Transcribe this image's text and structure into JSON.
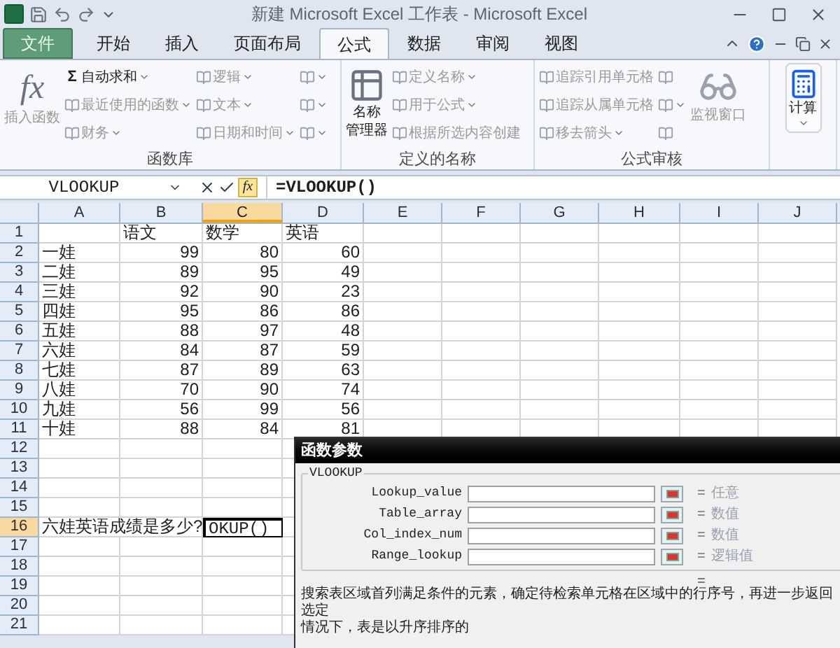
{
  "window": {
    "title": "新建 Microsoft Excel 工作表 - Microsoft Excel"
  },
  "tabs": [
    {
      "label": "文件",
      "kind": "file",
      "selected": false
    },
    {
      "label": "开始",
      "kind": "tab",
      "selected": false
    },
    {
      "label": "插入",
      "kind": "tab",
      "selected": false
    },
    {
      "label": "页面布局",
      "kind": "tab",
      "selected": false
    },
    {
      "label": "公式",
      "kind": "tab",
      "selected": true
    },
    {
      "label": "数据",
      "kind": "tab",
      "selected": false
    },
    {
      "label": "审阅",
      "kind": "tab",
      "selected": false
    },
    {
      "label": "视图",
      "kind": "tab",
      "selected": false
    }
  ],
  "ribbon": [
    {
      "label": "函数库",
      "items": [
        {
          "kind": "large",
          "glyph": "fx",
          "lines": [
            "插入函数"
          ],
          "disabled": true
        },
        {
          "kind": "stack",
          "buttons": [
            {
              "glyph": "Σ",
              "label": "自动求和",
              "dropdown": true,
              "disabled": false
            },
            {
              "label": "最近使用的函数",
              "dropdown": true,
              "disabled": true
            },
            {
              "label": "财务",
              "dropdown": true,
              "disabled": true
            }
          ]
        },
        {
          "kind": "stack",
          "buttons": [
            {
              "label": "逻辑",
              "dropdown": true,
              "disabled": true
            },
            {
              "label": "文本",
              "dropdown": true,
              "disabled": true
            },
            {
              "label": "日期和时间",
              "dropdown": true,
              "disabled": true
            }
          ]
        },
        {
          "kind": "stack",
          "buttons": [
            {
              "dropdown": true,
              "disabled": true
            },
            {
              "dropdown": true,
              "disabled": true
            },
            {
              "dropdown": true,
              "disabled": true
            }
          ]
        }
      ]
    },
    {
      "label": "定义的名称",
      "items": [
        {
          "kind": "large",
          "lines": [
            "名称",
            "管理器"
          ],
          "disabled": false
        },
        {
          "kind": "stack",
          "buttons": [
            {
              "label": "定义名称",
              "dropdown": true,
              "disabled": true
            },
            {
              "label": "用于公式",
              "dropdown": true,
              "disabled": true
            },
            {
              "label": "根据所选内容创建",
              "dropdown": false,
              "disabled": true
            }
          ]
        }
      ]
    },
    {
      "label": "公式审核",
      "items": [
        {
          "kind": "stack",
          "buttons": [
            {
              "label": "追踪引用单元格",
              "dropdown": false,
              "disabled": true
            },
            {
              "label": "追踪从属单元格",
              "dropdown": false,
              "disabled": true
            },
            {
              "label": "移去箭头",
              "dropdown": true,
              "disabled": true
            }
          ]
        },
        {
          "kind": "stack",
          "buttons": [
            {
              "dropdown": false,
              "disabled": true
            },
            {
              "dropdown": true,
              "disabled": true
            },
            {
              "dropdown": false,
              "disabled": true
            }
          ]
        },
        {
          "kind": "large",
          "lines": [
            "监视窗口"
          ],
          "disabled": true
        }
      ]
    },
    {
      "items": [
        {
          "kind": "large",
          "lines": [
            "计算"
          ],
          "dropdown": true,
          "disabled": false
        }
      ]
    }
  ],
  "formula_bar": {
    "name_box": "VLOOKUP",
    "fx": "fx",
    "formula": "=VLOOKUP()"
  },
  "columns": [
    {
      "label": "A",
      "selected": false
    },
    {
      "label": "B",
      "selected": false
    },
    {
      "label": "C",
      "selected": true
    },
    {
      "label": "D",
      "selected": false
    },
    {
      "label": "E",
      "selected": false
    },
    {
      "label": "F",
      "selected": false
    },
    {
      "label": "G",
      "selected": false
    },
    {
      "label": "H",
      "selected": false
    },
    {
      "label": "I",
      "selected": false
    },
    {
      "label": "J",
      "selected": false
    }
  ],
  "rows": [
    {
      "header": "1",
      "kind": "titles",
      "selected": false,
      "cells": [
        "",
        "语文",
        "数学",
        "英语"
      ]
    },
    {
      "header": "2",
      "kind": "record",
      "selected": false,
      "cells": [
        "一娃",
        "99",
        "80",
        "60"
      ]
    },
    {
      "header": "3",
      "kind": "record",
      "selected": false,
      "cells": [
        "二娃",
        "89",
        "95",
        "49"
      ]
    },
    {
      "header": "4",
      "kind": "record",
      "selected": false,
      "cells": [
        "三娃",
        "92",
        "90",
        "23"
      ]
    },
    {
      "header": "5",
      "kind": "record",
      "selected": false,
      "cells": [
        "四娃",
        "95",
        "86",
        "86"
      ]
    },
    {
      "header": "6",
      "kind": "record",
      "selected": false,
      "cells": [
        "五娃",
        "88",
        "97",
        "48"
      ]
    },
    {
      "header": "7",
      "kind": "record",
      "selected": false,
      "cells": [
        "六娃",
        "84",
        "87",
        "59"
      ]
    },
    {
      "header": "8",
      "kind": "record",
      "selected": false,
      "cells": [
        "七娃",
        "87",
        "89",
        "63"
      ]
    },
    {
      "header": "9",
      "kind": "record",
      "selected": false,
      "cells": [
        "八娃",
        "70",
        "90",
        "74"
      ]
    },
    {
      "header": "10",
      "kind": "record",
      "selected": false,
      "cells": [
        "九娃",
        "56",
        "99",
        "56"
      ]
    },
    {
      "header": "11",
      "kind": "record",
      "selected": false,
      "cells": [
        "十娃",
        "88",
        "84",
        "81"
      ]
    },
    {
      "header": "12",
      "kind": "empty",
      "selected": false,
      "cells": []
    },
    {
      "header": "13",
      "kind": "empty",
      "selected": false,
      "cells": []
    },
    {
      "header": "14",
      "kind": "empty",
      "selected": false,
      "cells": []
    },
    {
      "header": "15",
      "kind": "empty",
      "selected": false,
      "cells": []
    },
    {
      "header": "16",
      "kind": "question",
      "selected": true,
      "cells": [
        "六娃英语成绩是多少?",
        "",
        "OKUP()"
      ]
    },
    {
      "header": "17",
      "kind": "empty",
      "selected": false,
      "cells": []
    },
    {
      "header": "18",
      "kind": "empty",
      "selected": false,
      "cells": []
    },
    {
      "header": "19",
      "kind": "empty",
      "selected": false,
      "cells": []
    },
    {
      "header": "20",
      "kind": "empty",
      "selected": false,
      "cells": []
    },
    {
      "header": "21",
      "kind": "empty",
      "selected": false,
      "cells": []
    }
  ],
  "dialog": {
    "title": "函数参数",
    "function": "VLOOKUP",
    "arguments": [
      {
        "name": "Lookup_value",
        "equals": "=",
        "result": "任意"
      },
      {
        "name": "Table_array",
        "equals": "=",
        "result": "数值"
      },
      {
        "name": "Col_index_num",
        "equals": "=",
        "result": "数值"
      },
      {
        "name": "Range_lookup",
        "equals": "=",
        "result": "逻辑值"
      }
    ],
    "total": "=",
    "description": [
      "搜索表区域首列满足条件的元素，确定待检索单元格在区域中的行序号，再进一步返回选定",
      "情况下，表是以升序排序的"
    ]
  }
}
